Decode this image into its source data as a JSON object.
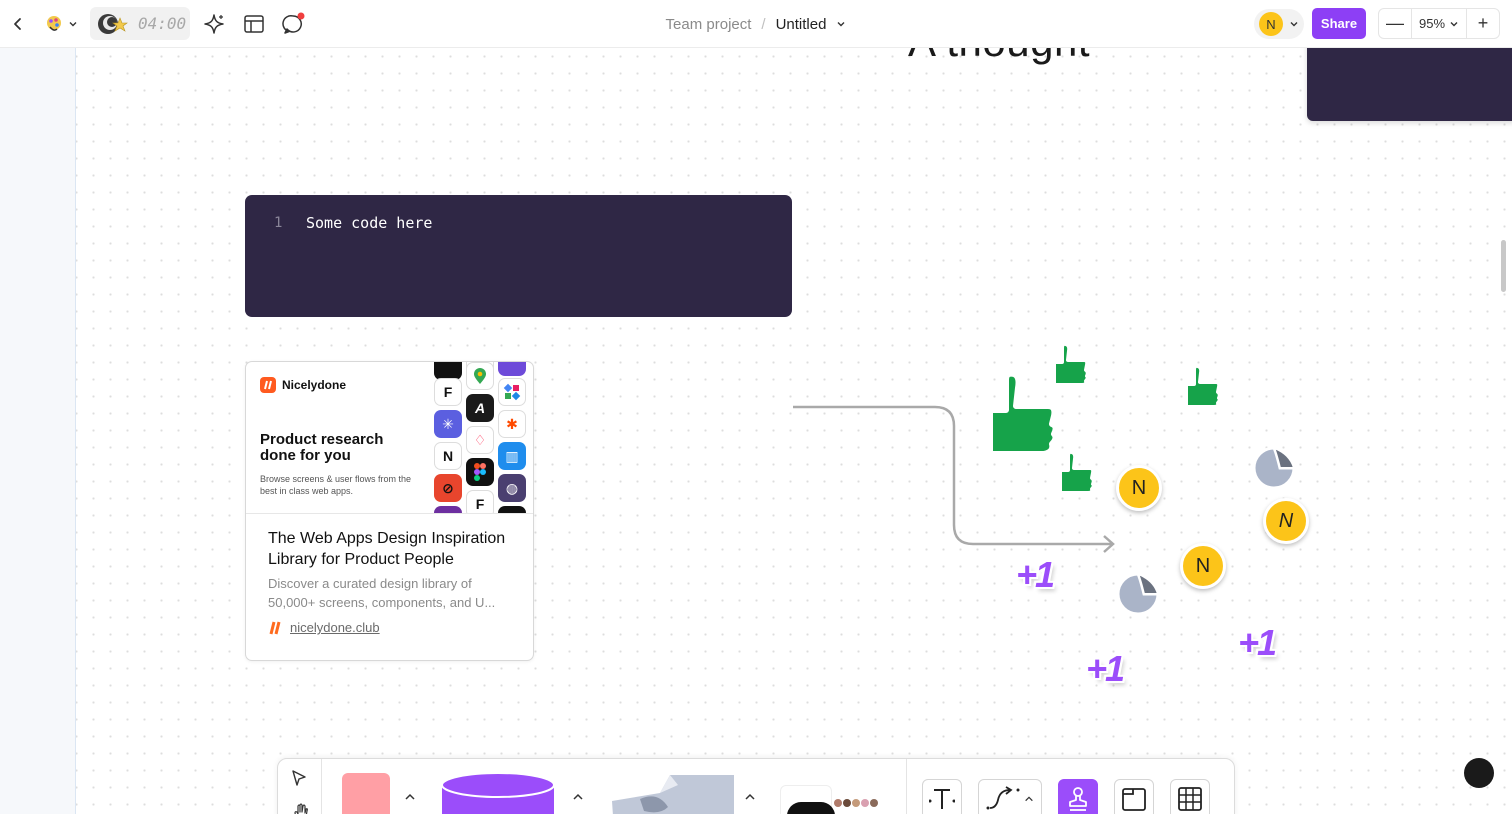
{
  "topbar": {
    "timer": "04:00",
    "breadcrumb_project": "Team project",
    "breadcrumb_separator": "/",
    "doc_title": "Untitled",
    "avatar_initial": "N",
    "share_label": "Share",
    "zoom_out_label": "—",
    "zoom_level": "95%",
    "zoom_in_label": "+"
  },
  "canvas": {
    "heading_text": "A thought",
    "code_block": {
      "line_number": "1",
      "code": "Some code here"
    },
    "link_card": {
      "brand": "Nicelydone",
      "preview_headline": "Product research done for you",
      "preview_subtitle": "Browse screens & user flows from the best in class web apps.",
      "title": "The Web Apps Design Inspiration Library for Product People",
      "description": "Discover a curated design library of 50,000+ screens, components, and U...",
      "url": "nicelydone.club"
    },
    "stickers": {
      "avatar_initial": "N",
      "plus_one_text": "+1"
    }
  },
  "colors": {
    "accent": "#8d3ff5",
    "dark_card": "#2f2745",
    "sticker_yellow": "#fcc419",
    "thumbs_green": "#16a34a",
    "plus_one_purple": "#9b4dfa"
  },
  "icons": [
    "back-chevron-icon",
    "color-palette-icon",
    "timer-icon",
    "sparkle-ai-icon",
    "layout-icon",
    "chat-notification-icon",
    "select-cursor-icon",
    "hand-pan-icon",
    "text-icon",
    "connector-icon",
    "stamp-icon",
    "frame-icon",
    "table-icon"
  ]
}
